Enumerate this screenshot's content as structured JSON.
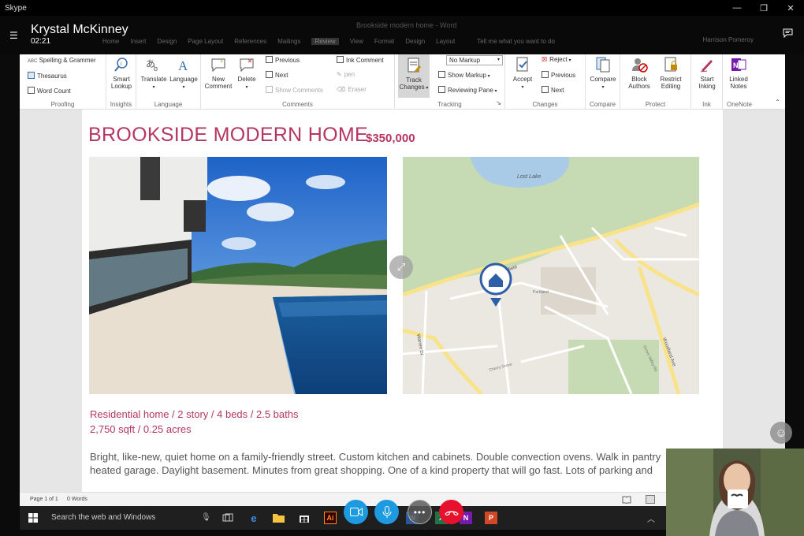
{
  "window": {
    "app_title": "Skype",
    "controls": [
      "—",
      "❐",
      "✕"
    ]
  },
  "call": {
    "caller": "Krystal McKinney",
    "duration": "02:21"
  },
  "word_ghost": {
    "doc_title": "Brookside modern home - Word",
    "tabs": [
      "Home",
      "Insert",
      "Design",
      "Page Layout",
      "References",
      "Mailings",
      "Review",
      "View",
      "Format",
      "Design",
      "Layout"
    ],
    "tell_me": "Tell me what you want to do",
    "user": "Harrison Pomeroy"
  },
  "ribbon": {
    "proofing": {
      "label": "Proofing",
      "items": [
        "Spelling & Grammer",
        "Thesaurus",
        "Word Count"
      ]
    },
    "insights": {
      "label": "Insights",
      "smart_lookup": "Smart\nLookup"
    },
    "language": {
      "label": "Language",
      "translate": "Translate",
      "language": "Language"
    },
    "comments": {
      "label": "Comments",
      "new_comment": "New\nComment",
      "delete": "Delete",
      "previous": "Previous",
      "next": "Next",
      "show_comments": "Show Comments",
      "ink_comment": "Ink Comment",
      "pen": "pen",
      "eraser": "Eraser"
    },
    "tracking": {
      "label": "Tracking",
      "track_changes": "Track\nChanges",
      "markup_select": "No Markup",
      "show_markup": "Show Markup",
      "reviewing_pane": "Reviewing Pane"
    },
    "changes": {
      "label": "Changes",
      "accept": "Accept",
      "reject": "Reject",
      "previous": "Previous",
      "next": "Next"
    },
    "compare": {
      "label": "Compare",
      "compare": "Compare"
    },
    "protect": {
      "label": "Protect",
      "block_authors": "Block\nAuthors",
      "restrict_editing": "Restrict\nEditing"
    },
    "ink": {
      "label": "Ink",
      "start_inking": "Start\nInking"
    },
    "onenote": {
      "label": "OneNote",
      "linked_notes": "Linked\nNotes"
    }
  },
  "document": {
    "title": "BROOKSIDE MODERN HOME",
    "price": "$350,000",
    "details_line1": "Residential home / 2 story / 4 beds / 2.5 baths",
    "details_line2": "2,750 sqft / 0.25 acres",
    "description_line1": "Bright, like-new, quiet home on a family-friendly street. Custom kitchen and cabinets. Double convection ovens. Walk in pantry",
    "description_line2": "heated garage. Daylight basement. Minutes from great shopping. One of a kind property that will go fast. Lots of parking and",
    "map_labels": {
      "lake": "Lost Lake",
      "ridgefield": "Ridgefield",
      "warren": "Warren Dr",
      "woodland": "Woodland Ave",
      "parkland": "Parkland",
      "cherry": "Cherry Grove",
      "grove": "Grove Valley Rd"
    }
  },
  "statusbar": {
    "page": "Page 1 of 1",
    "words": "0 Words"
  },
  "taskbar": {
    "search_placeholder": "Search the web and Windows"
  },
  "colors": {
    "accent_pink": "#b5365f",
    "skype_blue": "#1e9be0",
    "end_call_red": "#e8112d"
  }
}
